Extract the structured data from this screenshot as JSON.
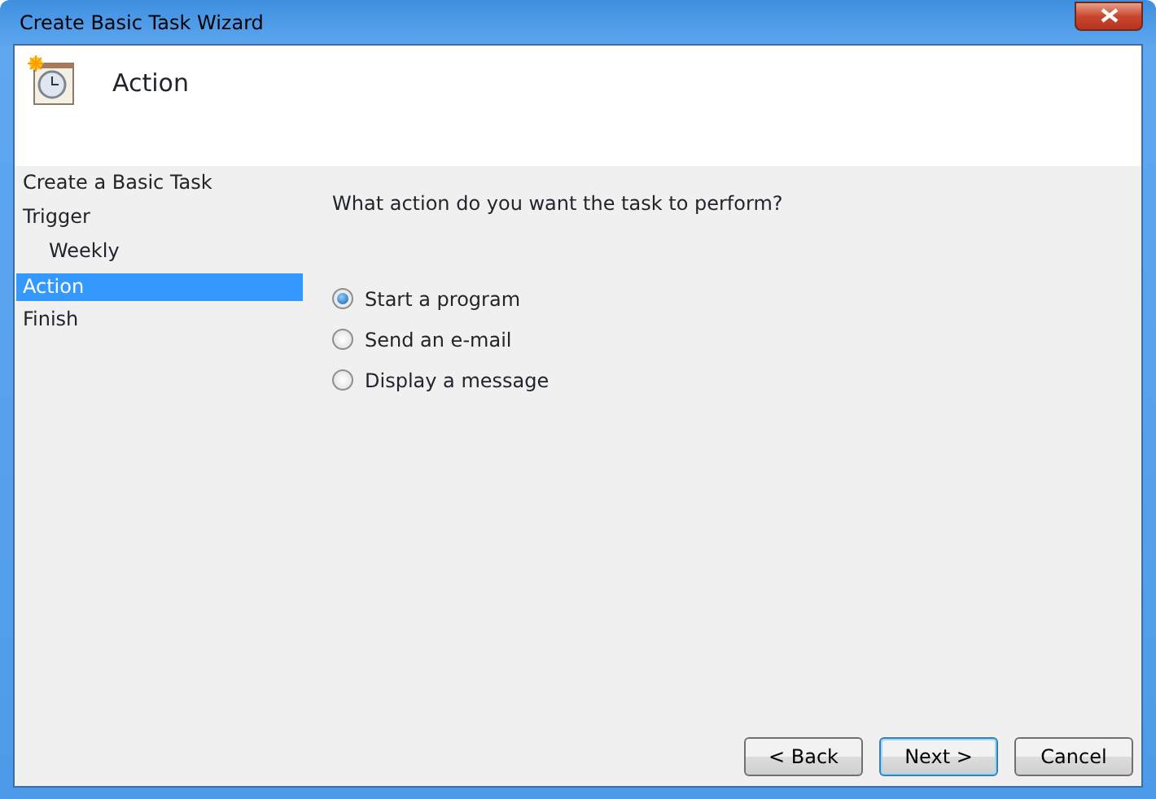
{
  "window": {
    "title": "Create Basic Task Wizard"
  },
  "header": {
    "title": "Action"
  },
  "steps": [
    {
      "label": "Create a Basic Task",
      "selected": false
    },
    {
      "label": "Trigger",
      "selected": false,
      "children": [
        {
          "label": "Weekly",
          "selected": false
        }
      ]
    },
    {
      "label": "Action",
      "selected": true
    },
    {
      "label": "Finish",
      "selected": false
    }
  ],
  "question": "What action do you want the task to perform?",
  "options": [
    {
      "label": "Start a program",
      "selected": true
    },
    {
      "label": "Send an e-mail",
      "selected": false
    },
    {
      "label": "Display a message",
      "selected": false
    }
  ],
  "buttons": [
    {
      "label": "< Back",
      "default": false
    },
    {
      "label": "Next >",
      "default": true
    },
    {
      "label": "Cancel",
      "default": false
    }
  ]
}
